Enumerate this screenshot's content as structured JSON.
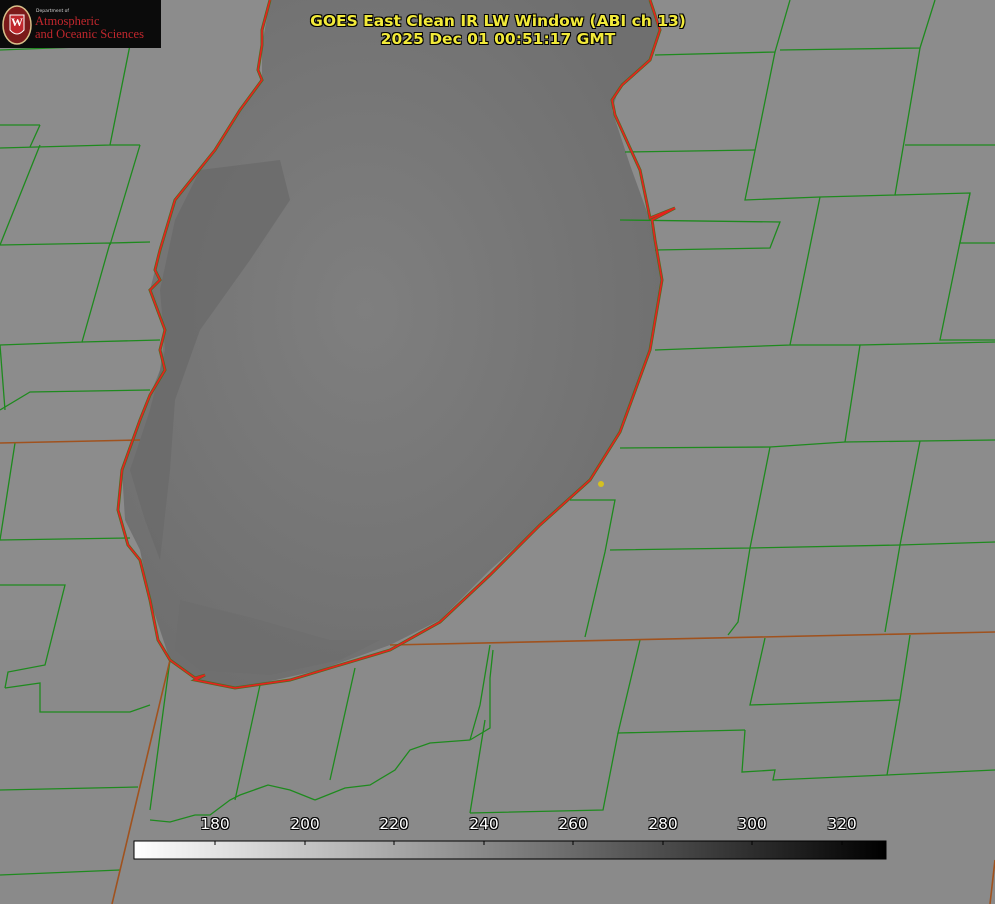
{
  "title": {
    "line1": "GOES East Clean IR LW Window (ABI ch 13)",
    "line2": "2025 Dec 01 00:51:17 GMT"
  },
  "logo": {
    "dept": "Department of",
    "line1": "Atmospheric",
    "line2": "and Oceanic Sciences",
    "emblem_letter": "W"
  },
  "colorbar": {
    "ticks": [
      "180",
      "200",
      "220",
      "240",
      "260",
      "280",
      "300",
      "320"
    ],
    "color_low": "#ffffff",
    "color_high": "#000000"
  },
  "colors": {
    "background_gray": "#8c8c8c",
    "county_lines": "#1e8a1e",
    "state_lines": "#a0521e",
    "coastline": "#e8201e",
    "title_text": "#f2ea3a",
    "logo_text": "#c0272d",
    "station_marker": "#d4c021"
  }
}
